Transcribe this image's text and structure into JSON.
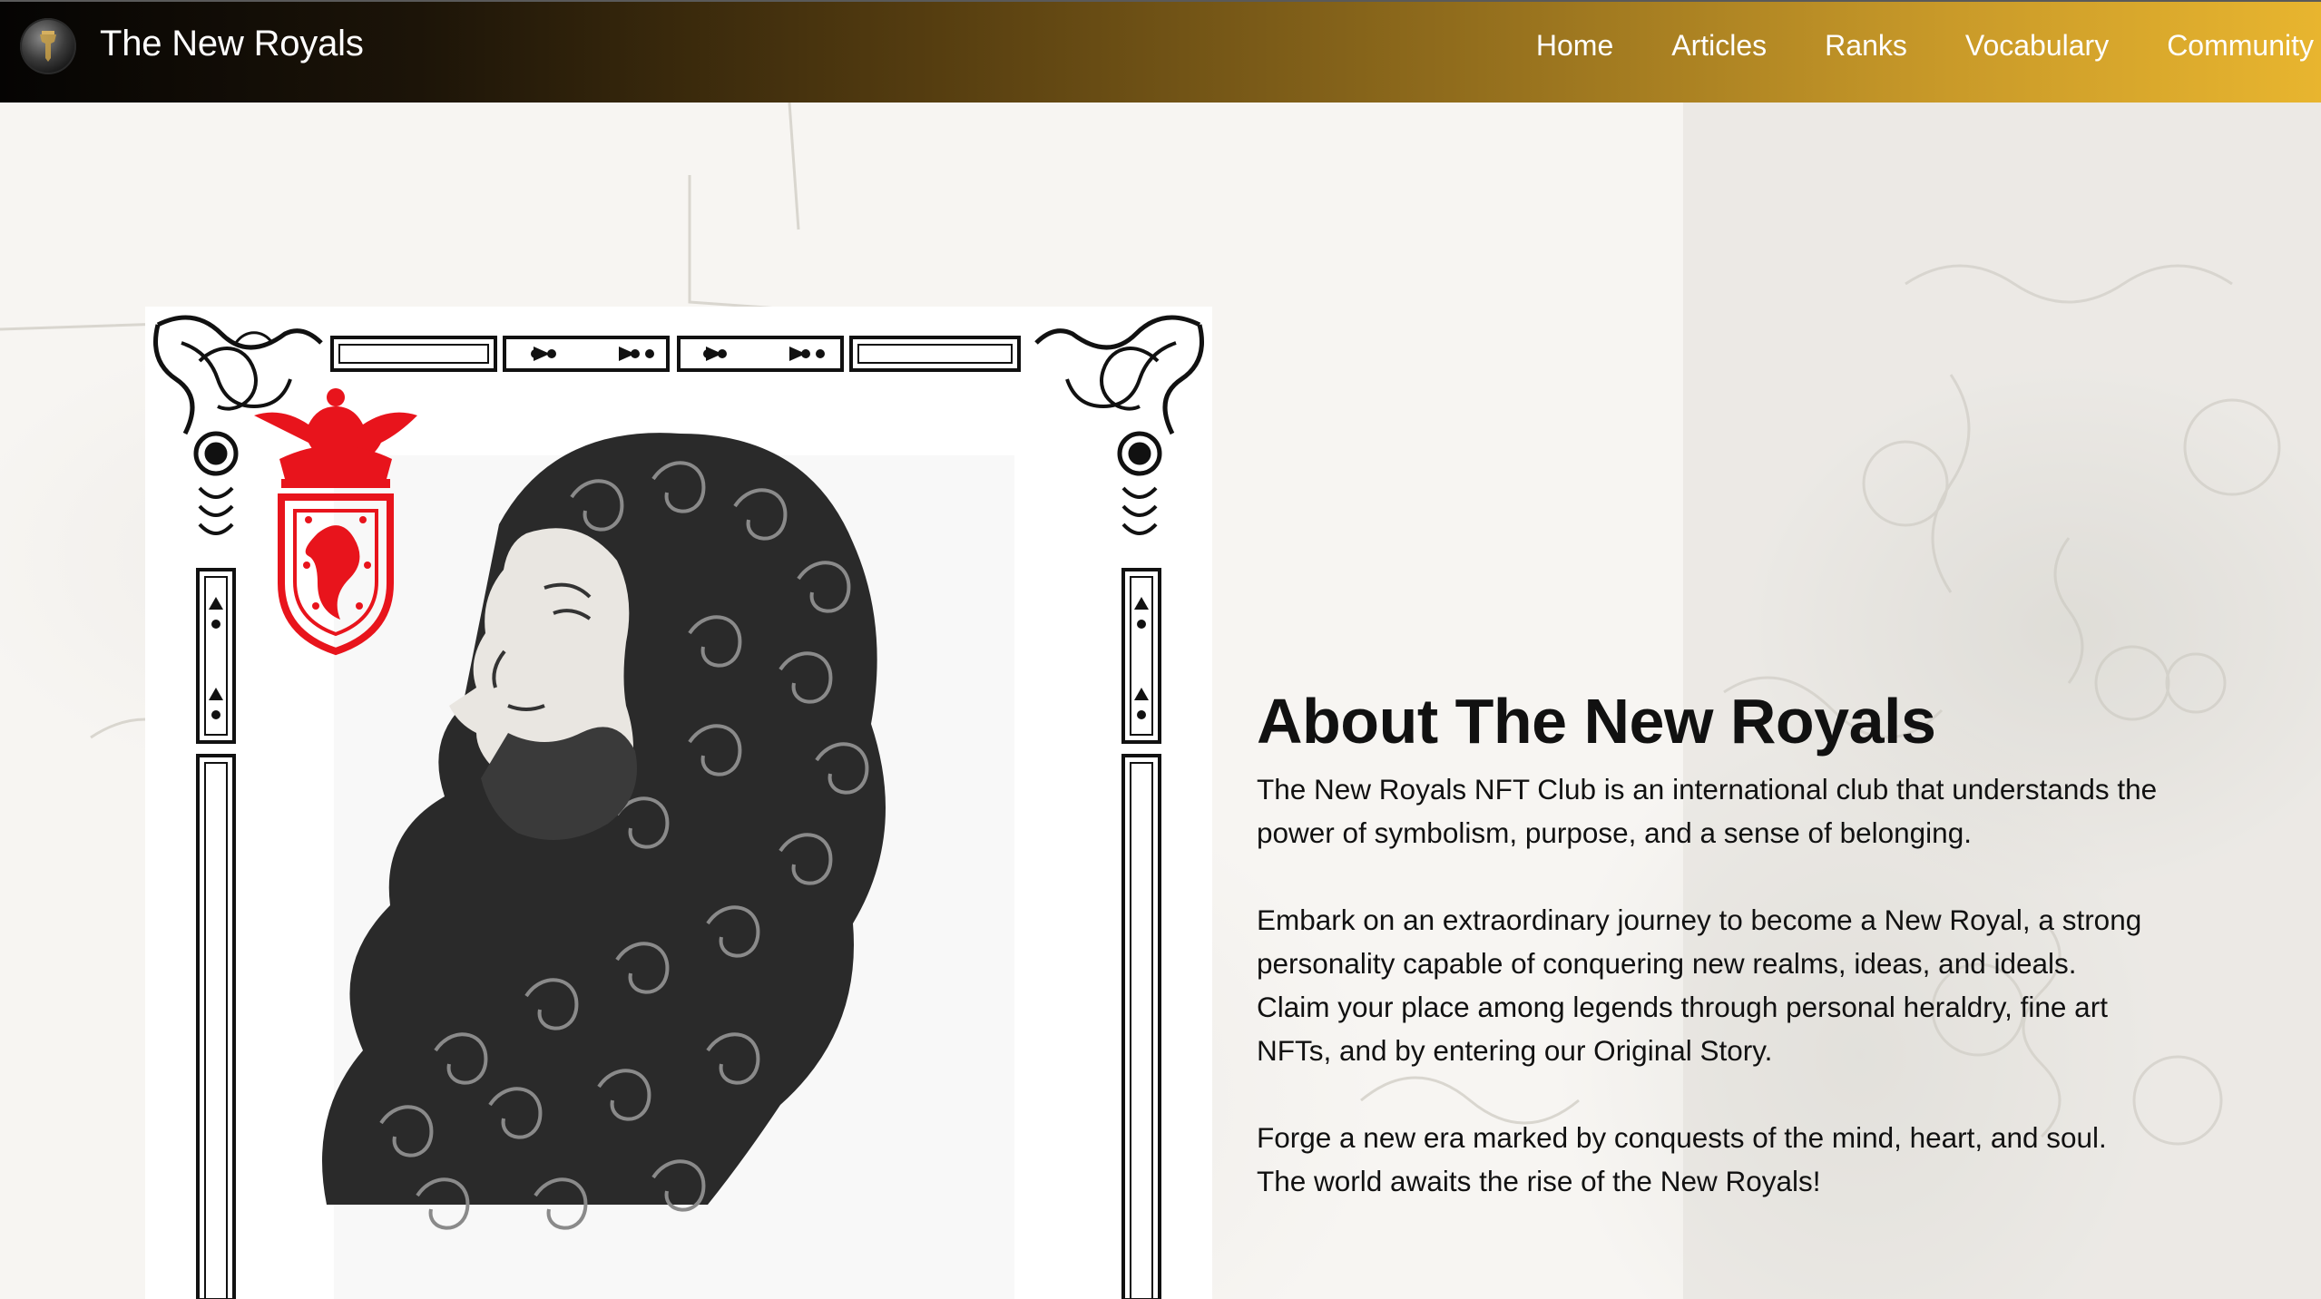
{
  "header": {
    "logo_icon": "crest-logo-icon",
    "title": "The New Royals",
    "nav": [
      {
        "label": "Home"
      },
      {
        "label": "Articles"
      },
      {
        "label": "Ranks"
      },
      {
        "label": "Vocabulary"
      },
      {
        "label": "Community"
      }
    ]
  },
  "about": {
    "heading": "About The New Royals",
    "paragraph_1": "The New Royals NFT Club is an international club that understands the power of symbolism, purpose, and a sense of belonging.",
    "paragraph_2a": "Embark on an extraordinary journey to become a New Royal, a strong personality capable of conquering new realms, ideas, and ideals.",
    "paragraph_2b": "Claim your place among legends through personal heraldry, fine art NFTs, and by entering our Original Story.",
    "paragraph_3a": "Forge a new era marked by conquests of the mind, heart, and soul.",
    "paragraph_3b": "The world awaits the rise of the New Royals!"
  },
  "colors": {
    "header_gradient_start": "#050403",
    "header_gradient_end": "#e8b52f",
    "heraldry_red": "#e8141c",
    "page_background": "#f7f5f2",
    "text": "#111111"
  }
}
